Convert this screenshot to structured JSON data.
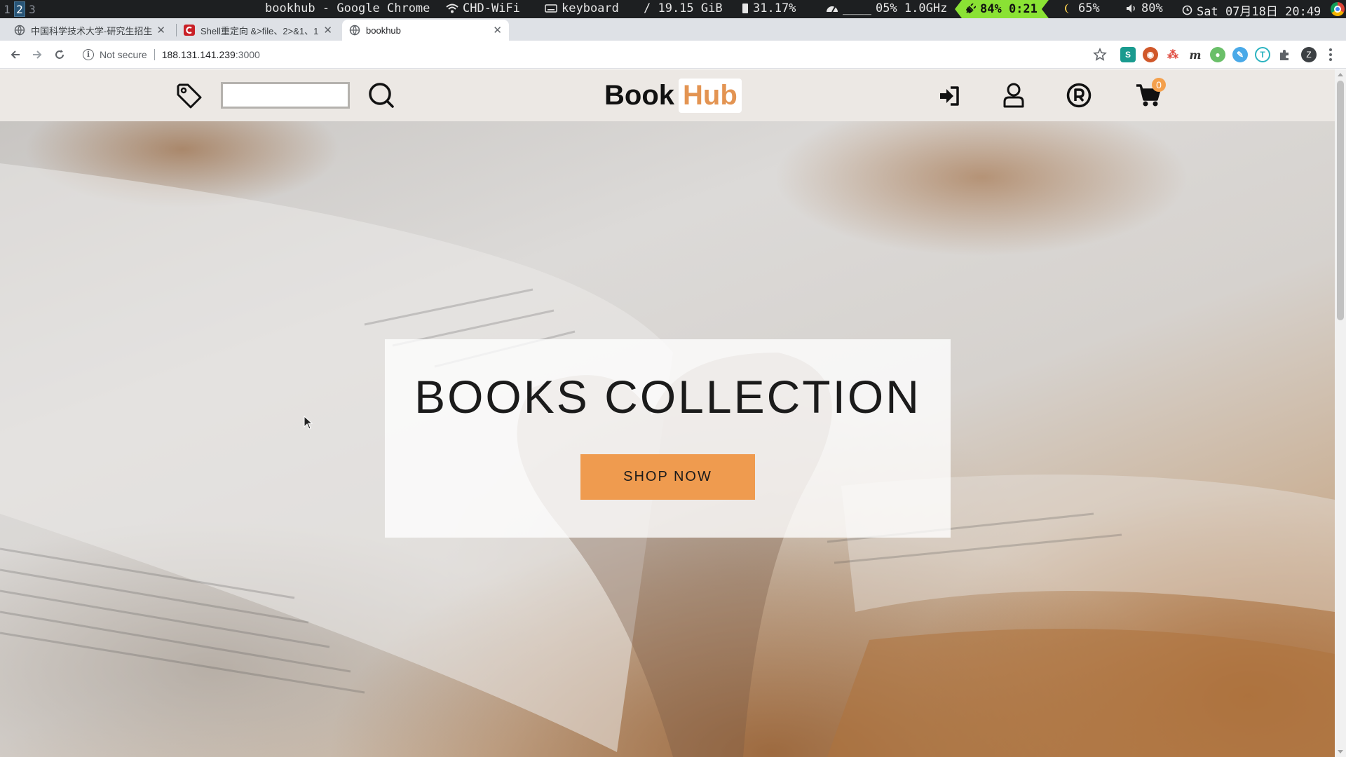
{
  "system_bar": {
    "workspaces": [
      "1",
      "2",
      "3"
    ],
    "active_workspace": "2",
    "window_title": "bookhub - Google Chrome",
    "wifi": "CHD-WiFi",
    "keyboard": "keyboard",
    "disk": "/ 19.15 GiB",
    "memory": "31.17%",
    "cpu": "05% 1.0GHz",
    "battery": "84% 0:21",
    "brightness": "65%",
    "volume": "80%",
    "clock": "Sat 07月18日 20:49",
    "colors": {
      "bar": "#1d1f21",
      "battery_bg": "#8ae234"
    }
  },
  "browser": {
    "tabs": [
      {
        "label": "中国科学技术大学-研究生招生",
        "icon": "globe-icon"
      },
      {
        "label": "Shell重定向 &>file、2>&1、1",
        "icon": "csdn-icon"
      },
      {
        "label": "bookhub",
        "icon": "globe-icon",
        "active": true
      }
    ],
    "new_tab_symbol": "+",
    "omnibox": {
      "security_label": "Not secure",
      "host": "188.131.141.239",
      "port": ":3000"
    },
    "profile_initial": "Z"
  },
  "site": {
    "search": {
      "value": "",
      "placeholder": ""
    },
    "brand": {
      "part1": "Book",
      "part2": "Hub"
    },
    "header_icons": [
      "tag-icon",
      "search-icon",
      "login-icon",
      "user-icon",
      "registered-icon",
      "cart-icon"
    ],
    "cart_count": "0",
    "hero": {
      "title": "BOOKS COLLECTION",
      "cta": "SHOP NOW"
    },
    "colors": {
      "header_bg": "#ece8e4",
      "accent": "#ef9b4f",
      "brand_hub": "#e39452",
      "badge": "#f4a04c"
    }
  }
}
